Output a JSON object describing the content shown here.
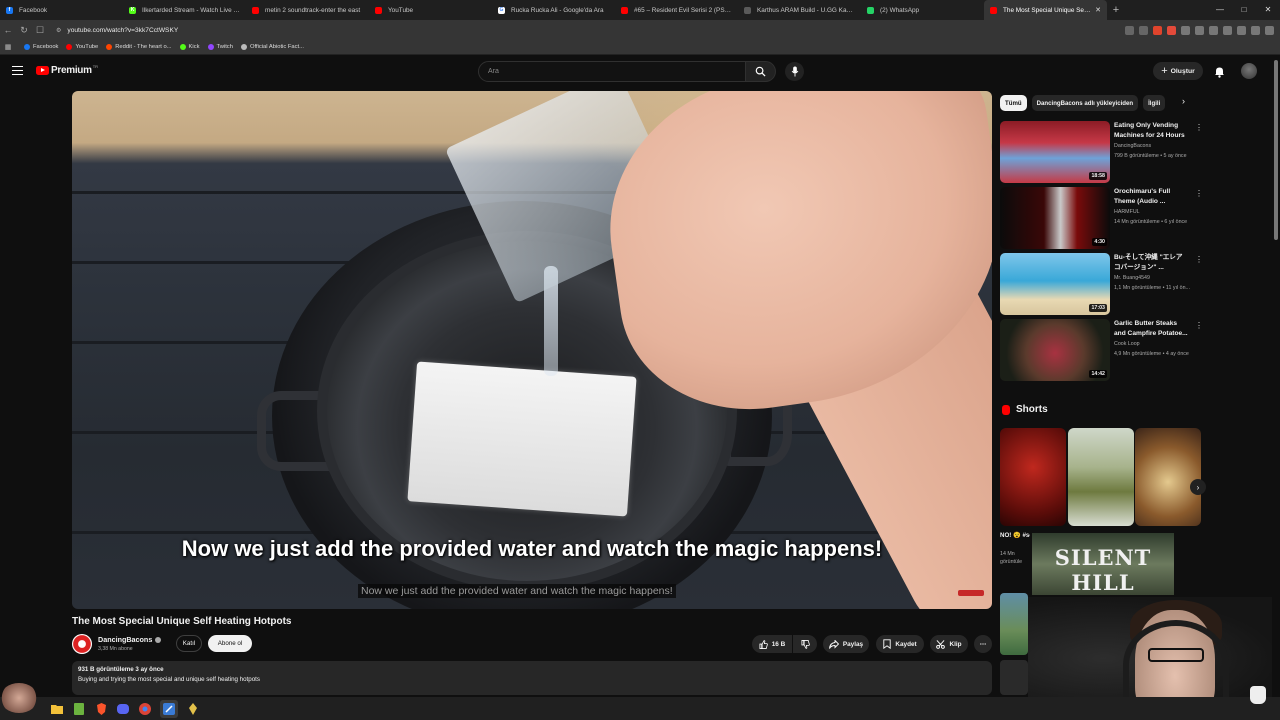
{
  "browser": {
    "tabs": [
      {
        "title": "Facebook",
        "color": "#1877f2",
        "glyph": "f",
        "active": false
      },
      {
        "title": "Ilkertarded Stream - Watch Live on K",
        "color": "#53fc18",
        "glyph": "K",
        "active": false
      },
      {
        "title": "metin 2 soundtrack-enter the east",
        "color": "#ff0000",
        "glyph": "",
        "active": false
      },
      {
        "title": "YouTube",
        "color": "#ff0000",
        "glyph": "",
        "active": false
      },
      {
        "title": "Rucka Rucka Ali - Google'da Ara",
        "color": "#ffffff",
        "glyph": "G",
        "active": false
      },
      {
        "title": "#65 – Resident Evil Serisi 2 (PS2 Dönem",
        "color": "#ff0000",
        "glyph": "",
        "active": false
      },
      {
        "title": "Karthus ARAM Build - U.GG Karthus",
        "color": "#5a5a5a",
        "glyph": "",
        "active": false
      },
      {
        "title": "(2) WhatsApp",
        "color": "#25d366",
        "glyph": "",
        "active": false
      },
      {
        "title": "The Most Special Unique Self Heating Hotpots",
        "color": "#ff0000",
        "glyph": "",
        "active": true
      }
    ],
    "url": "youtube.com/watch?v=3kk7CctWSKY",
    "bookmarks": [
      {
        "label": "Facebook",
        "color": "#1877f2"
      },
      {
        "label": "YouTube",
        "color": "#ff0000"
      },
      {
        "label": "Reddit - The heart o...",
        "color": "#ff4500"
      },
      {
        "label": "Kick",
        "color": "#53fc18"
      },
      {
        "label": "Twitch",
        "color": "#9146ff"
      },
      {
        "label": "Official Abiotic Fact...",
        "color": "#bbbbbb"
      }
    ]
  },
  "header": {
    "logo_text": "Premium",
    "logo_region": "TR",
    "search_placeholder": "Ara",
    "create_label": "Oluştur"
  },
  "player": {
    "subtitle": "Now we just add the provided water and watch the magic happens!",
    "subtitle_small": "Now we just add the provided water and watch the magic happens!"
  },
  "video": {
    "title": "The Most Special Unique Self Heating Hotpots",
    "channel": "DancingBacons",
    "subscribers": "3,38 Mn abone",
    "join_label": "Katıl",
    "subscribe_label": "Abone ol",
    "like_count": "16 B",
    "share_label": "Paylaş",
    "save_label": "Kaydet",
    "clip_label": "Klip",
    "views_line": "931 B görüntüleme  3 ay önce",
    "description": "Buying and trying the most special and unique self heating hotpots"
  },
  "sidebar": {
    "chips": [
      {
        "label": "Tümü",
        "selected": true
      },
      {
        "label": "DancingBacons adlı yükleyiciden",
        "selected": false
      },
      {
        "label": "İlgili",
        "selected": false
      }
    ],
    "recommendations": [
      {
        "title": "Eating Only Vending Machines for 24 Hours",
        "channel": "DancingBacons",
        "meta": "799 B görüntüleme • 5 ay önce",
        "duration": "18:58"
      },
      {
        "title": "Orochimaru's Full Theme (Audio ...",
        "channel": "HARMFUL",
        "meta": "14 Mn görüntüleme • 6 yıl önce",
        "duration": "4:30"
      },
      {
        "title": "Bu-そして沖縄 \"エレア コバージョン\" ...",
        "channel": "Mr. Buang4549",
        "meta": "1,1 Mn görüntüleme • 11 yıl ön...",
        "duration": "17:03"
      },
      {
        "title": "Garlic Butter Steaks and Campfire Potatoe...",
        "channel": "Cook Loop",
        "meta": "4,9 Mn görüntüleme • 4 ay önce",
        "duration": "14:42"
      }
    ],
    "shorts_title": "Shorts",
    "partial_title": "NO! 😵 #secret",
    "partial_meta": "14 Mn görüntüle",
    "overlay_text": "SILENT HILL"
  }
}
